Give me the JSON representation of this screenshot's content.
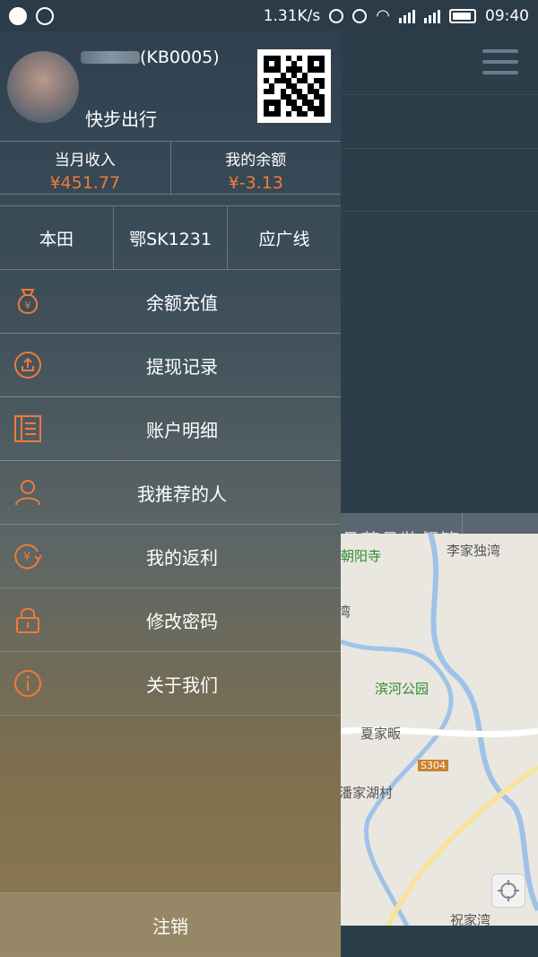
{
  "statusbar": {
    "speed": "1.31K/s",
    "time": "09:40"
  },
  "profile": {
    "user_id": "(KB0005)",
    "subtitle": "快步出行"
  },
  "stats": {
    "income_label": "当月收入",
    "income_value": "¥451.77",
    "balance_label": "我的余额",
    "balance_value": "¥-3.13"
  },
  "car": {
    "brand": "本田",
    "plate": "鄂SK1231",
    "line": "应广线"
  },
  "menu": [
    {
      "label": "余额充值",
      "icon": "money-bag-icon"
    },
    {
      "label": "提现记录",
      "icon": "upload-circle-icon"
    },
    {
      "label": "账户明细",
      "icon": "document-icon"
    },
    {
      "label": "我推荐的人",
      "icon": "person-icon"
    },
    {
      "label": "我的返利",
      "icon": "yen-refresh-icon"
    },
    {
      "label": "修改密码",
      "icon": "lock-icon"
    },
    {
      "label": "关于我们",
      "icon": "info-icon"
    }
  ],
  "logout_label": "注销",
  "background": {
    "strip_text": "品药品监督管",
    "map_labels": [
      "朝阳寺",
      "李家独湾",
      "湾",
      "滨河公园",
      "夏家畈",
      "S304",
      "潘家湖村",
      "祝家湾"
    ]
  },
  "colors": {
    "accent": "#f07a3a",
    "drawer_top": "#2f4150",
    "drawer_bottom": "#8c7a52"
  }
}
